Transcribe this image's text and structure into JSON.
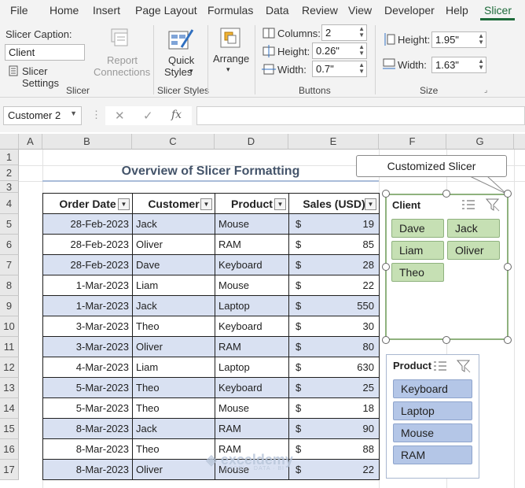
{
  "menu": {
    "tabs": [
      "File",
      "Home",
      "Insert",
      "Page Layout",
      "Formulas",
      "Data",
      "Review",
      "View",
      "Developer",
      "Help",
      "Slicer"
    ],
    "active": "Slicer"
  },
  "ribbon": {
    "slicer_group": {
      "caption_label": "Slicer Caption:",
      "caption_value": "Client",
      "settings_label": "Slicer Settings",
      "report_connections_line1": "Report",
      "report_connections_line2": "Connections",
      "group_label": "Slicer"
    },
    "styles_group": {
      "quick_styles_line1": "Quick",
      "quick_styles_line2": "Styles",
      "group_label": "Slicer Styles"
    },
    "arrange_label": "Arrange",
    "buttons_group": {
      "columns_label": "Columns:",
      "columns_value": "2",
      "height_label": "Height:",
      "height_value": "0.26\"",
      "width_label": "Width:",
      "width_value": "0.7\"",
      "group_label": "Buttons"
    },
    "size_group": {
      "height_label": "Height:",
      "height_value": "1.95\"",
      "width_label": "Width:",
      "width_value": "1.63\"",
      "group_label": "Size"
    }
  },
  "formula_bar": {
    "name_box": "Customer 2",
    "fx": "fx",
    "formula": ""
  },
  "grid": {
    "columns": [
      "A",
      "B",
      "C",
      "D",
      "E",
      "F",
      "G"
    ],
    "rows": [
      "1",
      "2",
      "3",
      "4",
      "5",
      "6",
      "7",
      "8",
      "9",
      "10",
      "11",
      "12",
      "13",
      "14",
      "15",
      "16",
      "17"
    ]
  },
  "sheet": {
    "title": "Overview of Slicer Formatting",
    "callout": "Customized Slicer",
    "table": {
      "headers": [
        "Order Date",
        "Customer",
        "Product",
        "Sales (USD)"
      ],
      "currency": "$",
      "rows": [
        [
          "28-Feb-2023",
          "Jack",
          "Mouse",
          "19"
        ],
        [
          "28-Feb-2023",
          "Oliver",
          "RAM",
          "85"
        ],
        [
          "28-Feb-2023",
          "Dave",
          "Keyboard",
          "28"
        ],
        [
          "1-Mar-2023",
          "Liam",
          "Mouse",
          "22"
        ],
        [
          "1-Mar-2023",
          "Jack",
          "Laptop",
          "550"
        ],
        [
          "3-Mar-2023",
          "Theo",
          "Keyboard",
          "30"
        ],
        [
          "3-Mar-2023",
          "Oliver",
          "RAM",
          "80"
        ],
        [
          "4-Mar-2023",
          "Liam",
          "Laptop",
          "630"
        ],
        [
          "5-Mar-2023",
          "Theo",
          "Keyboard",
          "25"
        ],
        [
          "5-Mar-2023",
          "Theo",
          "Mouse",
          "18"
        ],
        [
          "8-Mar-2023",
          "Jack",
          "RAM",
          "90"
        ],
        [
          "8-Mar-2023",
          "Theo",
          "RAM",
          "88"
        ],
        [
          "8-Mar-2023",
          "Oliver",
          "Mouse",
          "22"
        ]
      ]
    }
  },
  "slicers": {
    "client": {
      "header": "Client",
      "items": [
        "Dave",
        "Jack",
        "Liam",
        "Oliver",
        "Theo"
      ]
    },
    "product": {
      "header": "Product",
      "items": [
        "Keyboard",
        "Laptop",
        "Mouse",
        "RAM"
      ]
    }
  },
  "watermark": {
    "brand": "exceldemy",
    "tagline": "EXCEL · DATA · BI"
  },
  "colors": {
    "accent": "#1e6b3b",
    "band": "#d9e1f2",
    "client_button": "#c6e0b4",
    "product_button": "#b4c6e7",
    "title": "#44546a"
  }
}
